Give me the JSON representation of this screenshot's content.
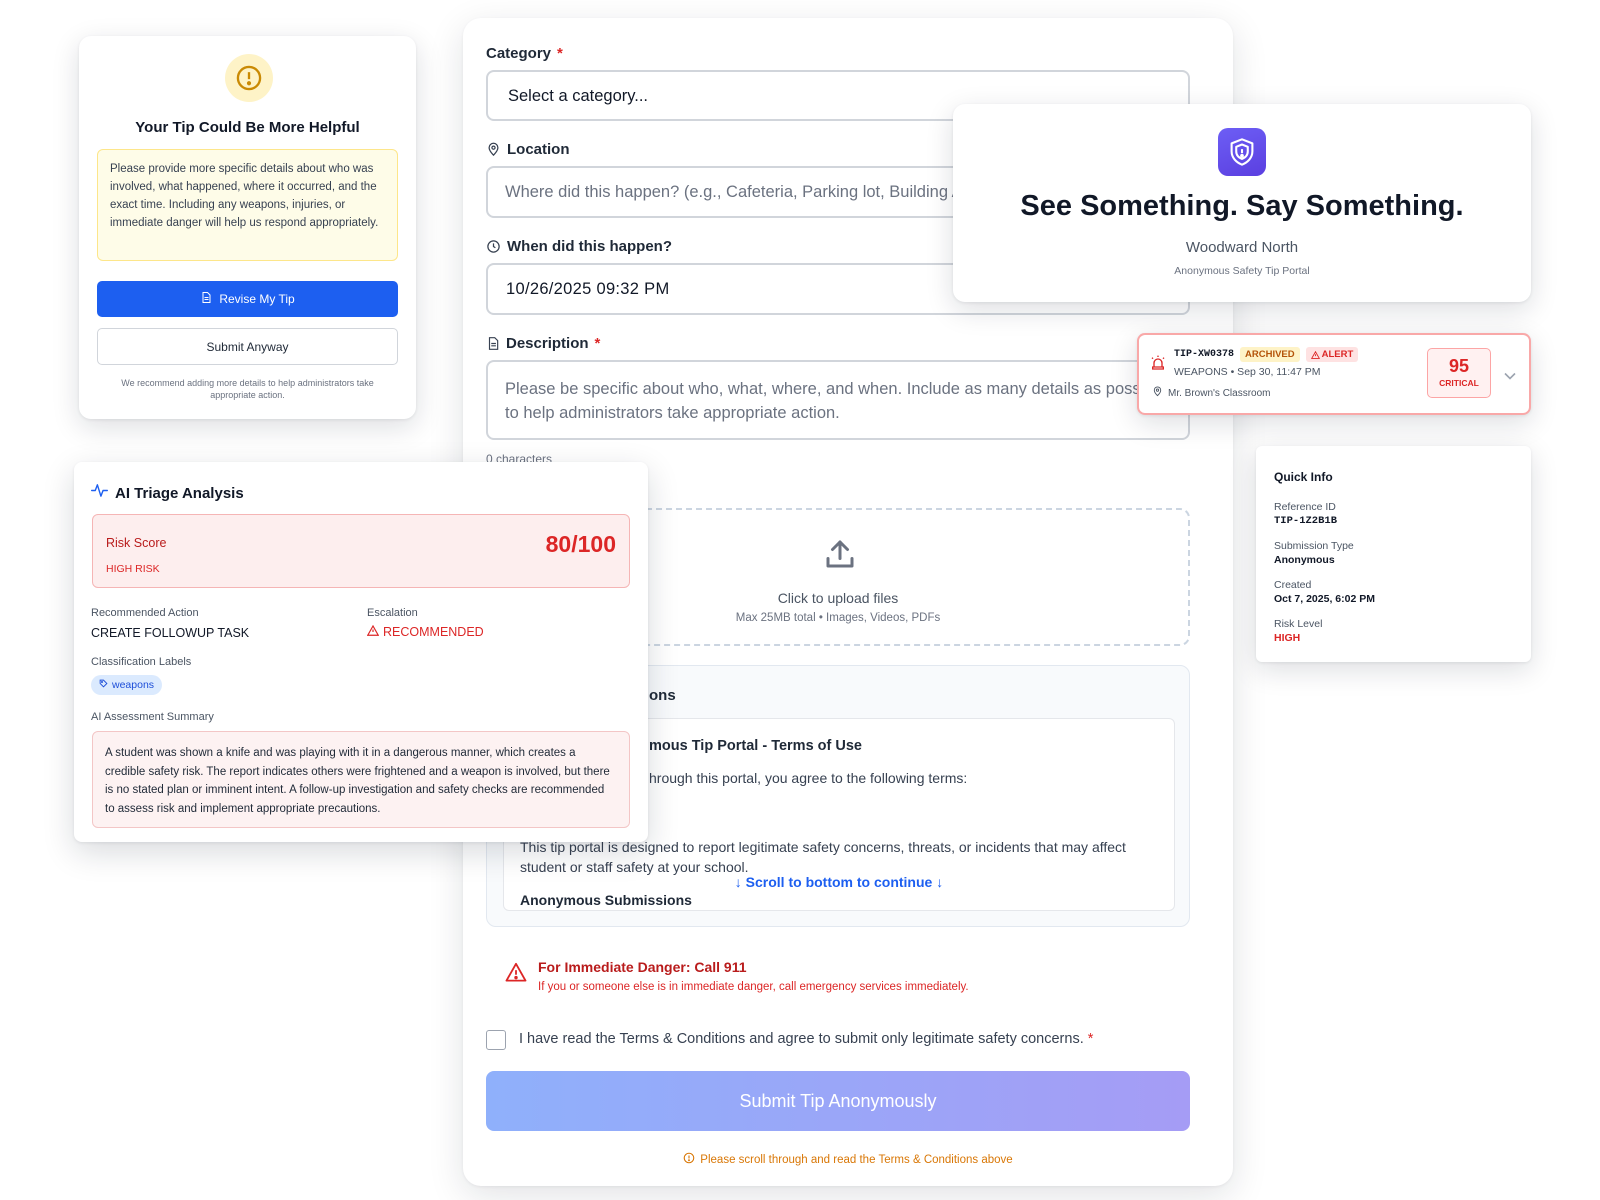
{
  "form": {
    "category": {
      "label": "Category",
      "value": "Select a category..."
    },
    "location": {
      "label": "Location",
      "placeholder": "Where did this happen? (e.g., Cafeteria, Parking lot, Building A)"
    },
    "when": {
      "label": "When did this happen?",
      "value": "10/26/2025 09:32 PM"
    },
    "description": {
      "label": "Description",
      "placeholder": "Please be specific about who, what, where, and when. Include as many details as possible to help administrators take appropriate action.",
      "char_count": "0 characters"
    },
    "attachments_label_fragment": ")",
    "upload": {
      "title": "Click to upload files",
      "subtitle": "Max 25MB total • Images, Videos, PDFs"
    },
    "terms": {
      "heading_fragment": "ons",
      "title_fragment": "mous Tip Portal - Terms of Use",
      "intro_fragment": "hrough this portal, you agree to the following terms:",
      "body": "This tip portal is designed to report legitimate safety concerns, threats, or incidents that may affect student or staff safety at your school.",
      "scroll_hint": "↓ Scroll to bottom to continue ↓",
      "next_section": "Anonymous Submissions"
    },
    "emergency": {
      "title": "For Immediate Danger: Call 911",
      "text": "If you or someone else is in immediate danger, call emergency services immediately."
    },
    "agree_label": "I have read the Terms & Conditions and agree to submit only legitimate safety concerns.",
    "submit_label": "Submit Tip Anonymously",
    "scroll_notice": "Please scroll through and read the Terms & Conditions above"
  },
  "hero": {
    "title": "See Something. Say Something.",
    "school": "Woodward North",
    "subtitle": "Anonymous Safety Tip Portal"
  },
  "tip_alert": {
    "id": "TIP-XW0378",
    "badge_archived": "ARCHIVED",
    "badge_alert": "ALERT",
    "meta": "WEAPONS • Sep 30, 11:47 PM",
    "location": "Mr. Brown's Classroom",
    "score": "95",
    "score_label": "CRITICAL"
  },
  "quick_info": {
    "title": "Quick Info",
    "fields": [
      {
        "label": "Reference ID",
        "value": "TIP-1Z2B1B"
      },
      {
        "label": "Submission Type",
        "value": "Anonymous"
      },
      {
        "label": "Created",
        "value": "Oct 7, 2025, 6:02 PM"
      },
      {
        "label": "Risk Level",
        "value": "HIGH"
      }
    ]
  },
  "helpful": {
    "title": "Your Tip Could Be More Helpful",
    "message": "Please provide more specific details about who was involved, what happened, where it occurred, and the exact time. Including any weapons, injuries, or immediate danger will help us respond appropriately.",
    "revise_label": "Revise My Tip",
    "submit_anyway_label": "Submit Anyway",
    "footnote": "We recommend adding more details to help administrators take appropriate action."
  },
  "triage": {
    "title": "AI Triage Analysis",
    "risk_label": "Risk Score",
    "risk_level": "HIGH RISK",
    "risk_score": "80/100",
    "rec_action_label": "Recommended Action",
    "rec_action_value": "CREATE FOLLOWUP TASK",
    "escalation_label": "Escalation",
    "escalation_value": "RECOMMENDED",
    "class_labels_label": "Classification Labels",
    "tag": "weapons",
    "summary_label": "AI Assessment Summary",
    "summary": "A student was shown a knife and was playing with it in a dangerous manner, which creates a credible safety risk. The report indicates others were frightened and a weapon is involved, but there is no stated plan or imminent intent. A follow-up investigation and safety checks are recommended to assess risk and implement appropriate precautions."
  },
  "colors": {
    "primary": "#1d5ff0",
    "danger": "#dc2626",
    "warning": "#d97706",
    "brand": "#5b3fe0"
  }
}
